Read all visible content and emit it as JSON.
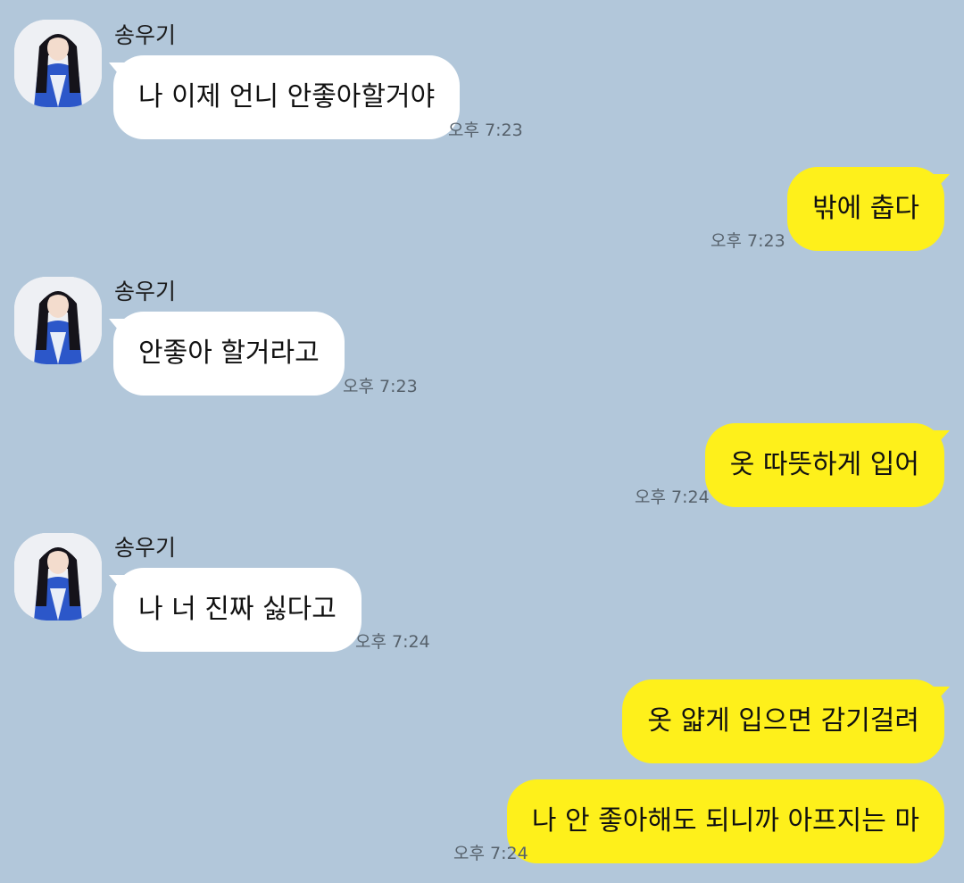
{
  "chat": {
    "contact_name": "송우기",
    "messages": [
      {
        "from": "them",
        "text": "나 이제 언니 안좋아할거야",
        "time": "오후 7:23"
      },
      {
        "from": "me",
        "text": "밖에 춥다",
        "time": "오후 7:23"
      },
      {
        "from": "them",
        "text": "안좋아 할거라고",
        "time": "오후 7:23"
      },
      {
        "from": "me",
        "text": "옷 따뜻하게 입어",
        "time": "오후 7:24"
      },
      {
        "from": "them",
        "text": "나 너 진짜 싫다고",
        "time": "오후 7:24"
      },
      {
        "from": "me",
        "text": "옷 얇게 입으면 감기걸려",
        "time": ""
      },
      {
        "from": "me",
        "text": "나 안 좋아해도 되니까 아프지는 마",
        "time": "오후 7:24"
      }
    ]
  },
  "colors": {
    "background": "#b2c7da",
    "incoming_bubble": "#ffffff",
    "outgoing_bubble": "#fef01b",
    "timestamp": "#56616b"
  }
}
